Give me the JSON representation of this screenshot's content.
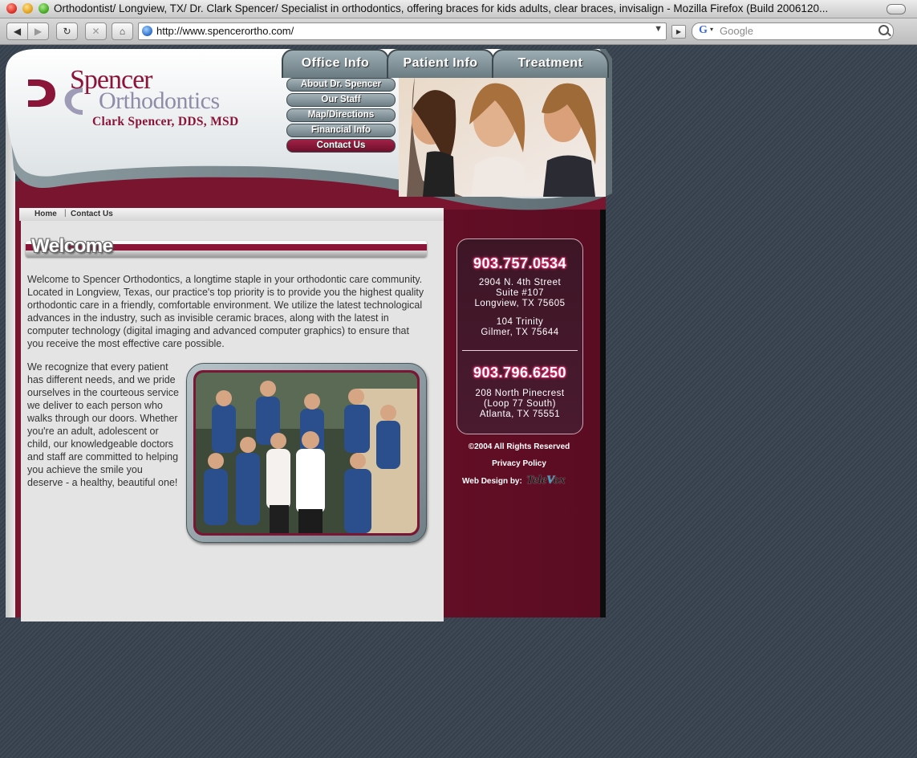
{
  "window": {
    "title": "Orthodontist/ Longview, TX/ Dr. Clark Spencer/ Specialist in orthodontics, offering braces for kids adults, clear braces, invisalign - Mozilla Firefox (Build 2006120..."
  },
  "toolbar": {
    "back_icon": "◀",
    "forward_icon": "▶",
    "reload_icon": "↻",
    "stop_icon": "✕",
    "home_icon": "⌂",
    "url": "http://www.spencerortho.com/",
    "url_dropdown_icon": "▼",
    "go_icon": "▶",
    "search_engine_icon": "G",
    "search_engine_dropdown_icon": "▾",
    "search_placeholder": "Google"
  },
  "header": {
    "logo_name": "Spencer",
    "logo_practice": "Orthodontics",
    "logo_doctor": "Clark Spencer, DDS, MSD",
    "tabs": [
      "Office Info",
      "Patient Info",
      "Treatment"
    ],
    "submenu": [
      "About Dr. Spencer",
      "Our Staff",
      "Map/Directions",
      "Financial Info",
      "Contact Us"
    ]
  },
  "breadcrumb": {
    "home": "Home",
    "separator": "|",
    "contact": "Contact Us"
  },
  "main": {
    "heading": "Welcome",
    "intro": "Welcome to Spencer Orthodontics, a longtime staple in your orthodontic care community. Located in Longview, Texas, our practice's top priority is to provide you the highest quality orthodontic care in a friendly, comfortable environment. We utilize the latest technological advances in the industry, such as invisible ceramic braces, along with the latest in computer technology (digital imaging and advanced computer graphics) to ensure that you receive the most effective care possible.",
    "second": "We recognize that every patient has different needs, and we pride ourselves in the courteous service we deliver to each person who walks through our doors. Whether you're an adult, adolescent or child, our knowledgeable doctors and staff are committed to helping you achieve the smile you deserve - a healthy, beautiful one!"
  },
  "contact": {
    "phone_1": "903.757.0534",
    "longview": [
      "2904 N. 4th Street",
      "Suite #107",
      "Longview, TX 75605"
    ],
    "gilmer": [
      "104 Trinity",
      "Gilmer, TX 75644"
    ],
    "phone_2": "903.796.6250",
    "atlanta": [
      "208 North Pinecrest",
      "(Loop 77 South)",
      "Atlanta,  TX  75551"
    ]
  },
  "footer": {
    "copyright": "©2004 All Rights Reserved",
    "privacy": "Privacy Policy",
    "webdesign": "Web Design by:",
    "televox_pre": "Tele",
    "televox_v": "V",
    "televox_post": "ox"
  },
  "colors": {
    "brand_maroon": "#8a1538",
    "logo_lilac": "#8f8ca8",
    "nav_slate": "#7f9096",
    "page_background": "#3b4553"
  }
}
